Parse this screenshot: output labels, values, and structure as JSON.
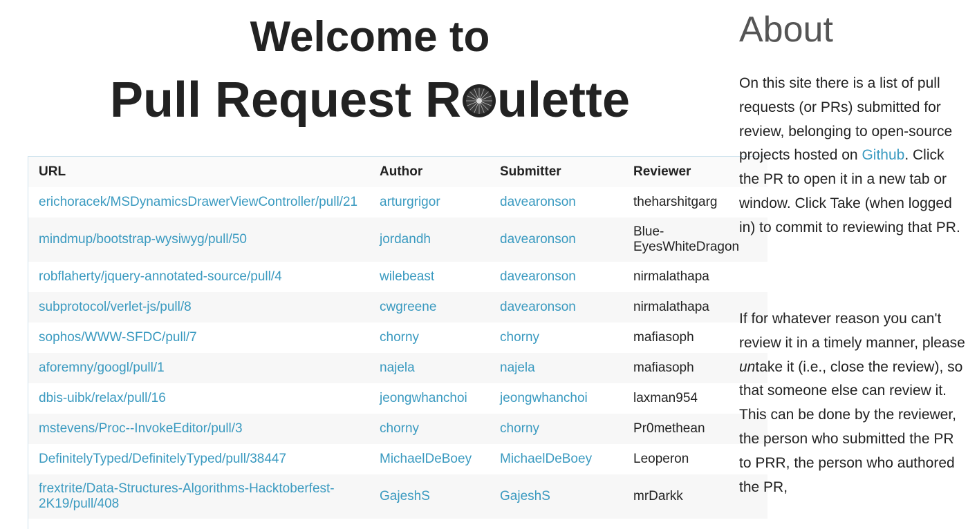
{
  "hero": {
    "line1": "Welcome to",
    "line2_before": "Pull Request R",
    "line2_after": "ulette"
  },
  "table": {
    "headers": [
      "URL",
      "Author",
      "Submitter",
      "Reviewer"
    ],
    "rows": [
      {
        "url": "erichoracek/MSDynamicsDrawerViewController/pull/21",
        "author": "arturgrigor",
        "submitter": "davearonson",
        "reviewer": "theharshitgarg"
      },
      {
        "url": "mindmup/bootstrap-wysiwyg/pull/50",
        "author": "jordandh",
        "submitter": "davearonson",
        "reviewer": "Blue-EyesWhiteDragon"
      },
      {
        "url": "robflaherty/jquery-annotated-source/pull/4",
        "author": "wilebeast",
        "submitter": "davearonson",
        "reviewer": "nirmalathapa"
      },
      {
        "url": "subprotocol/verlet-js/pull/8",
        "author": "cwgreene",
        "submitter": "davearonson",
        "reviewer": "nirmalathapa"
      },
      {
        "url": "sophos/WWW-SFDC/pull/7",
        "author": "chorny",
        "submitter": "chorny",
        "reviewer": "mafiasoph"
      },
      {
        "url": "aforemny/googl/pull/1",
        "author": "najela",
        "submitter": "najela",
        "reviewer": "mafiasoph"
      },
      {
        "url": "dbis-uibk/relax/pull/16",
        "author": "jeongwhanchoi",
        "submitter": "jeongwhanchoi",
        "reviewer": "laxman954"
      },
      {
        "url": "mstevens/Proc--InvokeEditor/pull/3",
        "author": "chorny",
        "submitter": "chorny",
        "reviewer": "Pr0methean"
      },
      {
        "url": "DefinitelyTyped/DefinitelyTyped/pull/38447",
        "author": "MichaelDeBoey",
        "submitter": "MichaelDeBoey",
        "reviewer": "Leoperon"
      },
      {
        "url": "frextrite/Data-Structures-Algorithms-Hacktoberfest-2K19/pull/408",
        "author": "GajeshS",
        "submitter": "GajeshS",
        "reviewer": "mrDarkk"
      }
    ]
  },
  "about": {
    "title": "About",
    "p1_before": "On this site there is a list of pull requests (or PRs) submitted for review, belonging to open-source projects hosted on ",
    "p1_link": "Github",
    "p1_after": ".  Click the PR to open it in a new tab or window.  Click Take (when logged in) to commit to reviewing that PR.",
    "p2_before": "If for whatever reason you can't review it in a timely manner, please ",
    "p2_em": "un",
    "p2_after": "take it (i.e., close the review), so that someone else can review it.  This can be done by the reviewer, the person who submitted the PR to PRR, the person who authored the PR,"
  },
  "colors": {
    "link": "#3a9ac0",
    "text": "#222222",
    "about_heading": "#555555"
  },
  "icons": {
    "roulette_wheel": "roulette-wheel-icon"
  }
}
